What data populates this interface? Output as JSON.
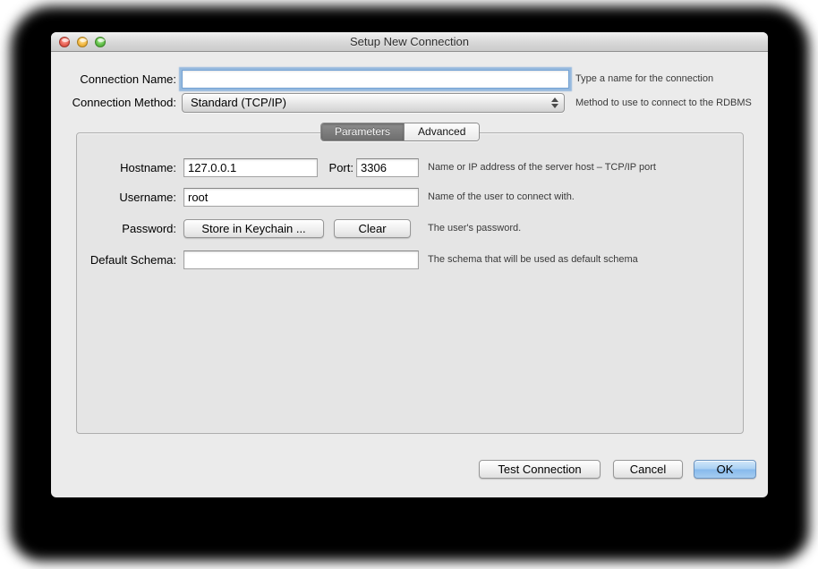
{
  "window": {
    "title": "Setup New Connection"
  },
  "header_fields": {
    "connection_name": {
      "label": "Connection Name:",
      "value": "",
      "help": "Type a name for the connection"
    },
    "connection_method": {
      "label": "Connection Method:",
      "value": "Standard (TCP/IP)",
      "help": "Method to use to connect to the RDBMS"
    }
  },
  "tabs": [
    {
      "label": "Parameters",
      "selected": true
    },
    {
      "label": "Advanced",
      "selected": false
    }
  ],
  "parameters": {
    "hostname": {
      "label": "Hostname:",
      "value": "127.0.0.1"
    },
    "port": {
      "label": "Port:",
      "value": "3306"
    },
    "hostname_help": "Name or IP address of the server host – TCP/IP port",
    "username": {
      "label": "Username:",
      "value": "root",
      "help": "Name of the user to connect with."
    },
    "password": {
      "label": "Password:",
      "store_button": "Store in Keychain ...",
      "clear_button": "Clear",
      "help": "The user's password."
    },
    "default_schema": {
      "label": "Default Schema:",
      "value": "",
      "help": "The schema that will be used as default schema"
    }
  },
  "footer": {
    "test_connection_button": "Test Connection",
    "cancel_button": "Cancel",
    "ok_button": "OK"
  },
  "colors": {
    "focus_ring": "#78a8d9",
    "selected_tab": "#757575",
    "ok_blue": "#8cbcec"
  }
}
